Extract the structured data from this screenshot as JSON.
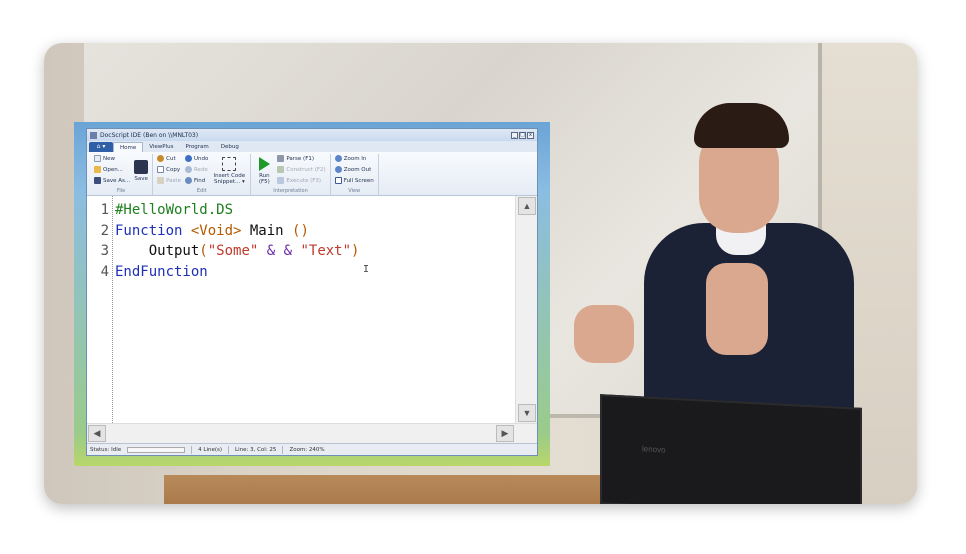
{
  "window": {
    "title": "DocScript IDE (Ben on \\\\MNLT03)",
    "controls": [
      "_",
      "□",
      "x"
    ]
  },
  "tabs": {
    "app_button": "⌂ ▾",
    "items": [
      "Home",
      "ViewPlus",
      "Program",
      "Debug"
    ]
  },
  "ribbon": {
    "file": {
      "new": "New",
      "open": "Open...",
      "save_as": "Save As...",
      "save": "Save",
      "label": "File"
    },
    "edit": {
      "cut": "Cut",
      "copy": "Copy",
      "paste": "Paste",
      "undo": "Undo",
      "redo": "Redo",
      "find": "Find",
      "insert_code": "Insert Code Snippet... ▾",
      "label": "Edit"
    },
    "interpretation": {
      "run": "Run (F5)",
      "parse": "Parse (F1)",
      "construct": "Construct (F2)",
      "execute": "Execute (F3)",
      "label": "Interpretation"
    },
    "view": {
      "zoom_in": "Zoom In",
      "zoom_out": "Zoom Out",
      "full_screen": "Full Screen",
      "label": "View"
    }
  },
  "editor": {
    "line_numbers": [
      "1",
      "2",
      "3",
      "4"
    ],
    "line1": "#HelloWorld.DS",
    "line2_kw": "Function",
    "line2_type": "<Void>",
    "line2_name": " Main ",
    "line2_paren": "()",
    "line3_indent": "    ",
    "line3_func": "Output",
    "line3_open": "(",
    "line3_str1": "\"Some\"",
    "line3_op": " & & ",
    "line3_str2": "\"Text\"",
    "line3_close": ")",
    "line4": "EndFunction"
  },
  "status": {
    "state": "Status: Idle",
    "lines": "4 Line(s)",
    "position": "Line: 3, Col: 25",
    "zoom": "Zoom: 240%"
  },
  "laptop": {
    "brand": "lenovo"
  },
  "colors": {
    "comment": "#1e7f1e",
    "keyword": "#1f2fb8",
    "type": "#b35a00",
    "string": "#c0392b",
    "operator": "#6a2aa8"
  }
}
